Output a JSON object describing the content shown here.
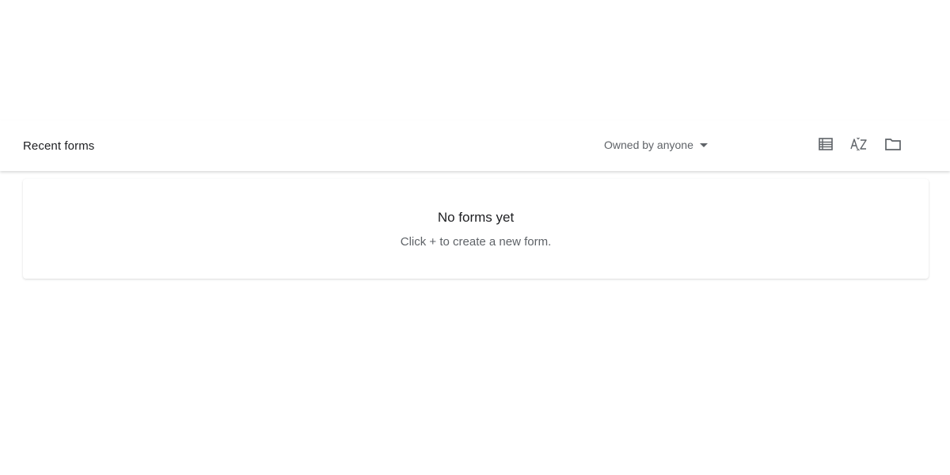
{
  "header": {
    "title": "Recent forms",
    "owner_filter": "Owned by anyone",
    "icons": {
      "list": "list-view-icon",
      "sort": "sort-az-icon",
      "folder": "folder-icon"
    }
  },
  "empty_state": {
    "title": "No forms yet",
    "subtitle": "Click + to create a new form."
  },
  "colors": {
    "text_primary": "#202124",
    "text_secondary": "#5f6368",
    "background": "#ffffff"
  }
}
